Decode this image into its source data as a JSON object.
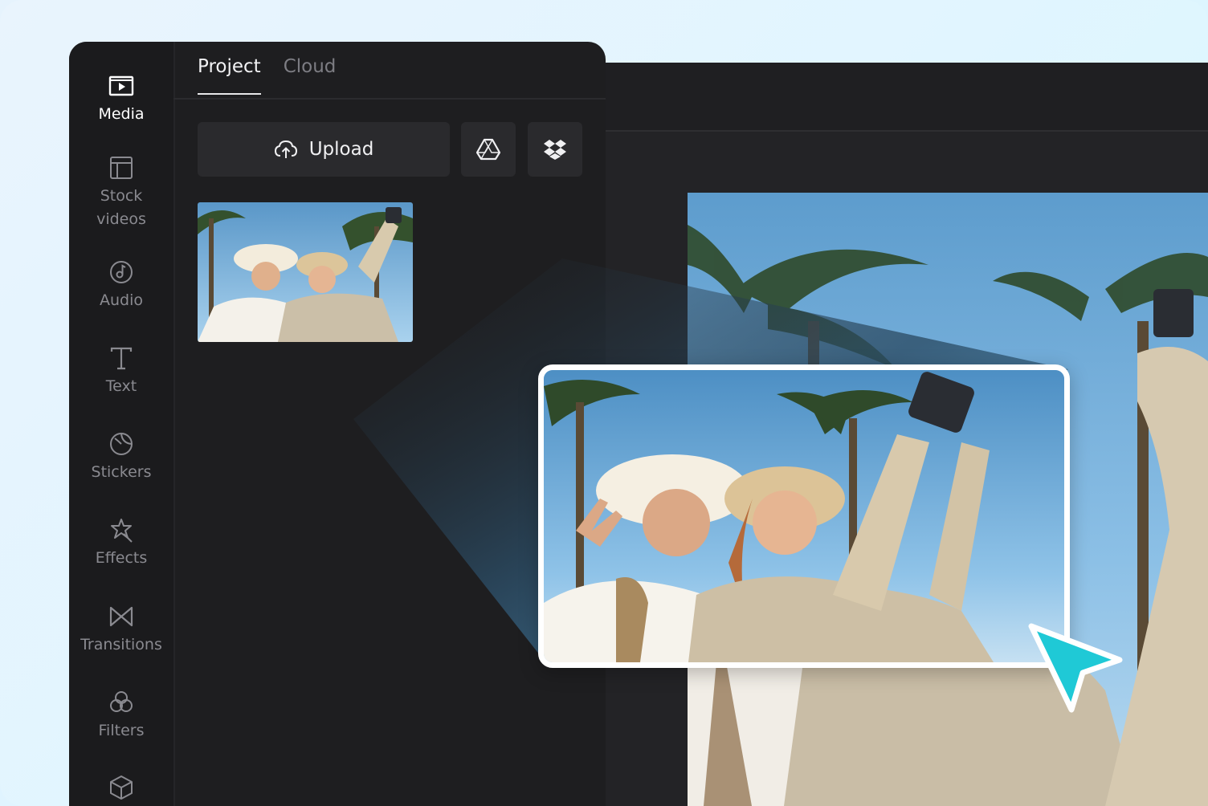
{
  "sidebar": {
    "items": [
      {
        "label": "Media",
        "icon": "media-icon",
        "active": true
      },
      {
        "label": "Stock\nvideos",
        "icon": "stock-videos-icon",
        "active": false
      },
      {
        "label": "Audio",
        "icon": "audio-icon",
        "active": false
      },
      {
        "label": "Text",
        "icon": "text-icon",
        "active": false
      },
      {
        "label": "Stickers",
        "icon": "stickers-icon",
        "active": false
      },
      {
        "label": "Effects",
        "icon": "effects-icon",
        "active": false
      },
      {
        "label": "Transitions",
        "icon": "transitions-icon",
        "active": false
      },
      {
        "label": "Filters",
        "icon": "filters-icon",
        "active": false
      },
      {
        "label": "",
        "icon": "cube-icon",
        "active": false
      }
    ]
  },
  "panel": {
    "tabs": [
      {
        "label": "Project",
        "active": true
      },
      {
        "label": "Cloud",
        "active": false
      }
    ],
    "upload_label": "Upload",
    "google_drive_icon": "google-drive-icon",
    "dropbox_icon": "dropbox-icon"
  },
  "colors": {
    "cursor": "#1fc9d6",
    "panel_bg": "#1e1e20",
    "accent_frame": "#ffffff"
  }
}
